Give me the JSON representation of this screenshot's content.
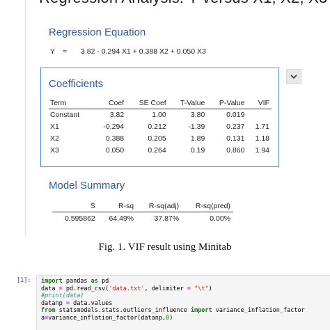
{
  "report": {
    "window_title": "Regression Analysis: Y versus X1, X2, X3",
    "regression_equation": {
      "heading": "Regression Equation",
      "lhs": "Y",
      "equals": "=",
      "rhs": "3.82 - 0.294 X1 + 0.388 X2 + 0.050 X3"
    },
    "coefficients": {
      "heading": "Coefficients",
      "columns": [
        "Term",
        "Coef",
        "SE Coef",
        "T-Value",
        "P-Value",
        "VIF"
      ],
      "rows": [
        [
          "Constant",
          "3.82",
          "1.00",
          "3.80",
          "0.019",
          ""
        ],
        [
          "X1",
          "-0.294",
          "0.212",
          "-1.39",
          "0.237",
          "1.71"
        ],
        [
          "X2",
          "0.388",
          "0.205",
          "1.89",
          "0.131",
          "1.18"
        ],
        [
          "X3",
          "0.050",
          "0.264",
          "0.19",
          "0.860",
          "1.94"
        ]
      ]
    },
    "model_summary": {
      "heading": "Model Summary",
      "columns": [
        "S",
        "R-sq",
        "R-sq(adj)",
        "R-sq(pred)"
      ],
      "rows": [
        [
          "0.595862",
          "64.49%",
          "37.87%",
          "0.00%"
        ]
      ]
    },
    "expand_icon": "chevron-down-icon"
  },
  "caption": "Fig. 1. VIF result using Minitab",
  "notebook": {
    "prompt": "[1]:",
    "code": {
      "line1": {
        "kw1": "import",
        "mid": " pandas ",
        "kw2": "as",
        "tail": " pd"
      },
      "line2": {
        "head": "data ",
        "eq": "=",
        "mid": " pd.read_csv(",
        "s1": "'data.txt'",
        "sep": ", delimiter ",
        "eq2": "=",
        "sp": " ",
        "s2": "\"\\t\"",
        "tail": ")"
      },
      "line3": "#print(data)",
      "line4": {
        "head": "datanp ",
        "eq": "=",
        "tail": " data.values"
      },
      "line5": {
        "kw1": "from",
        "mid": " statsmodels.stats.outliers_influence ",
        "kw2": "import",
        "tail": " variance_inflation_factor"
      },
      "line6": {
        "head": "a",
        "eq": "=",
        "mid": "variance_inflation_factor(datanp,",
        "num": "0",
        "tail": ")"
      }
    }
  }
}
